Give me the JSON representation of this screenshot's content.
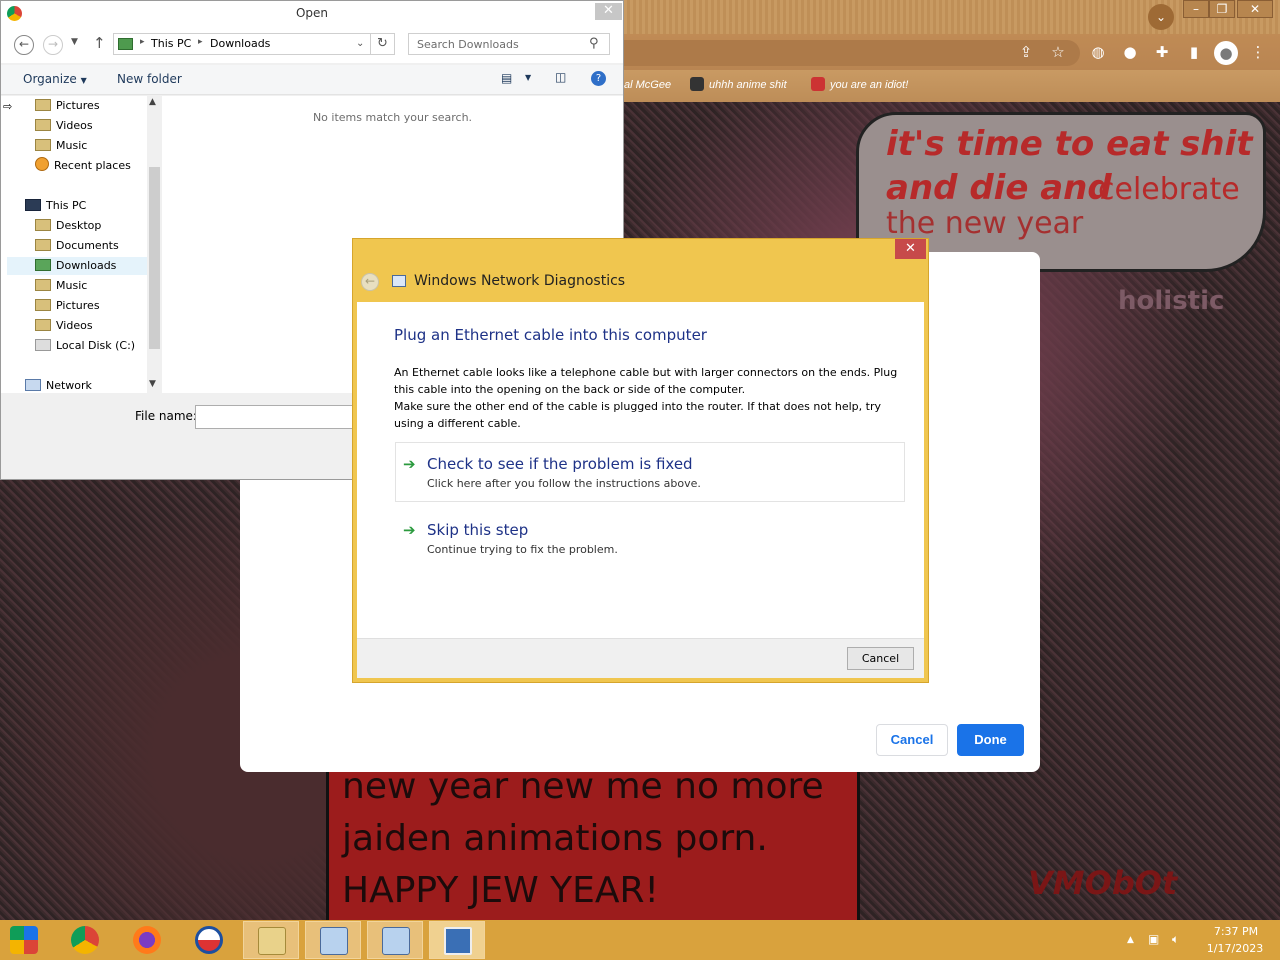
{
  "browser": {
    "bookmarks": [
      {
        "label": "al McGee"
      },
      {
        "label": "uhhh anime shit"
      },
      {
        "label": "you are an idiot!"
      }
    ],
    "bubble_lines": [
      "it's time to eat shit",
      "and die and",
      "celebrate",
      "the new year"
    ],
    "bubble_sub": "holistic",
    "comic_lines": [
      "new year new me no more",
      "jaiden animations porn.",
      "HAPPY JEW YEAR!"
    ],
    "watermark": "VMObOt",
    "card": {
      "cancel_label": "Cancel",
      "done_label": "Done"
    },
    "accent": "#1a73e8"
  },
  "open_dialog": {
    "title": "Open",
    "close_glyph": "✕",
    "breadcrumb": [
      "This PC",
      "Downloads"
    ],
    "search_placeholder": "Search Downloads",
    "commands": {
      "organize": "Organize",
      "new_folder": "New folder"
    },
    "nav_items": [
      {
        "label": "Pictures",
        "icon": "pictures-folder-icon"
      },
      {
        "label": "Videos",
        "icon": "videos-folder-icon"
      },
      {
        "label": "Music",
        "icon": "music-folder-icon"
      },
      {
        "label": "Recent places",
        "icon": "recent-places-icon"
      },
      {
        "label": "This PC",
        "icon": "computer-icon"
      },
      {
        "label": "Desktop",
        "icon": "desktop-folder-icon"
      },
      {
        "label": "Documents",
        "icon": "documents-folder-icon"
      },
      {
        "label": "Downloads",
        "icon": "downloads-folder-icon",
        "selected": true
      },
      {
        "label": "Music",
        "icon": "music-folder-icon"
      },
      {
        "label": "Pictures",
        "icon": "pictures-folder-icon"
      },
      {
        "label": "Videos",
        "icon": "videos-folder-icon"
      },
      {
        "label": "Local Disk (C:)",
        "icon": "disk-icon"
      },
      {
        "label": "Network",
        "icon": "network-icon"
      }
    ],
    "empty_message": "No items match your search.",
    "file_name_label": "File name:",
    "file_name_value": ""
  },
  "diagnostics": {
    "title": "Windows Network Diagnostics",
    "close_glyph": "✕",
    "heading": "Plug an Ethernet cable into this computer",
    "para1": "An Ethernet cable looks like a telephone cable but with larger connectors on the ends. Plug this cable into the opening on the back or side of the computer.",
    "para2": "Make sure the other end of the cable is plugged into the router. If that does not help, try using a different cable.",
    "option1": {
      "title": "Check to see if the problem is fixed",
      "sub": "Click here after you follow the instructions above."
    },
    "option2": {
      "title": "Skip this step",
      "sub": "Continue trying to fix the problem."
    },
    "cancel_label": "Cancel",
    "title_bar_color": "#f0c64f"
  },
  "taskbar": {
    "time": "7:37 PM",
    "date": "1/17/2023",
    "color": "#d9a23d",
    "apps": [
      "start-icon",
      "chrome-icon",
      "firefox-icon",
      "obama-logo-icon",
      "file-explorer-icon",
      "network-diagnostics-icon",
      "network-diagnostics-icon",
      "remote-desktop-icon"
    ]
  }
}
